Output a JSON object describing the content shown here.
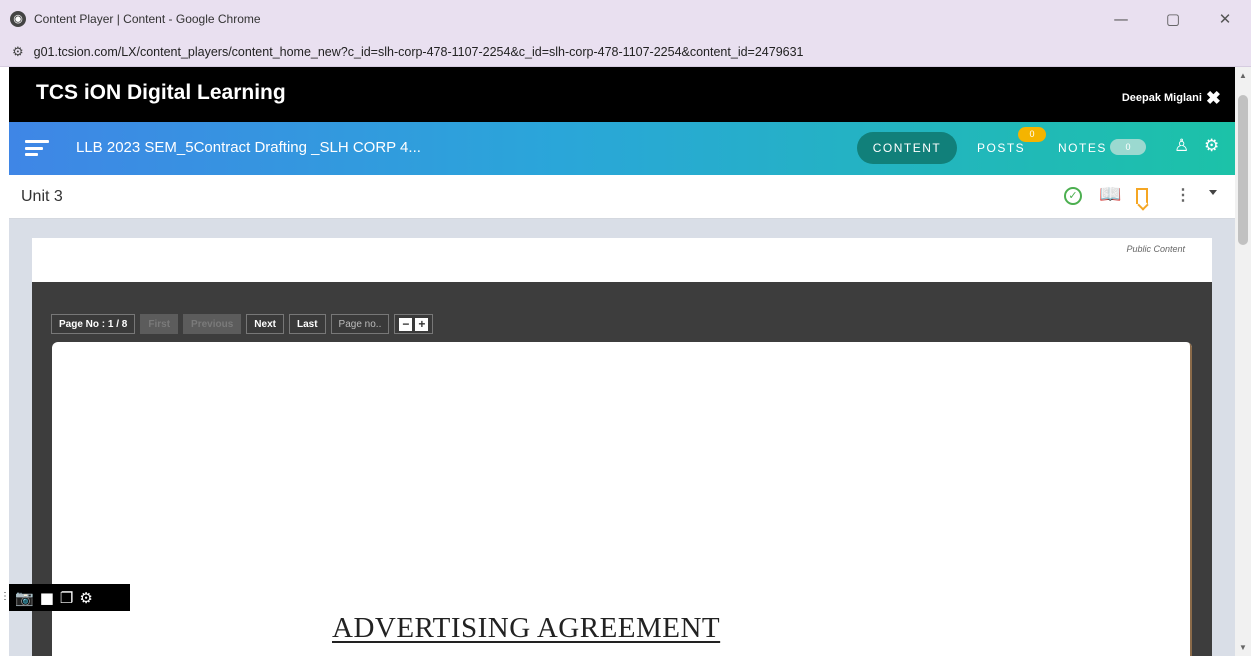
{
  "window": {
    "title": "Content Player | Content - Google Chrome",
    "url": "g01.tcsion.com/LX/content_players/content_home_new?c_id=slh-corp-478-1107-2254&c_id=slh-corp-478-1107-2254&content_id=2479631",
    "controls": {
      "minimize": "—",
      "maximize": "▢",
      "close": "✕"
    }
  },
  "header": {
    "brand": "TCS iON Digital Learning",
    "user_name": "Deepak Miglani"
  },
  "course_bar": {
    "title": "LLB 2023 SEM_5Contract Drafting _SLH CORP 4...",
    "tabs": {
      "content": "CONTENT",
      "posts": "POSTS",
      "notes": "NOTES"
    },
    "posts_count": "0",
    "notes_count": "0"
  },
  "unit_bar": {
    "title": "Unit 3"
  },
  "content": {
    "visibility_label": "Public Content",
    "pager": {
      "page_info": "Page No : 1 / 8",
      "first": "First",
      "previous": "Previous",
      "next": "Next",
      "last": "Last",
      "page_placeholder": "Page no.."
    },
    "document_heading": "ADVERTISING AGREEMENT"
  },
  "icons": [
    "globe-icon",
    "tune-icon",
    "menu-icon",
    "close-icon",
    "hierarchy-icon",
    "settings-icon",
    "check-circle-icon",
    "book-icon",
    "bookmark-icon",
    "more-vert-icon",
    "caret-down-icon",
    "camera-icon",
    "video-icon",
    "window-icon",
    "gear-icon"
  ],
  "colors": {
    "brand_bar": "#000000",
    "gradient_start": "#3f86e6",
    "gradient_end": "#1cc2a8",
    "posts_badge": "#f5b400",
    "check": "#4caf50",
    "book": "#1e88e5",
    "bookmark": "#f5a623"
  }
}
